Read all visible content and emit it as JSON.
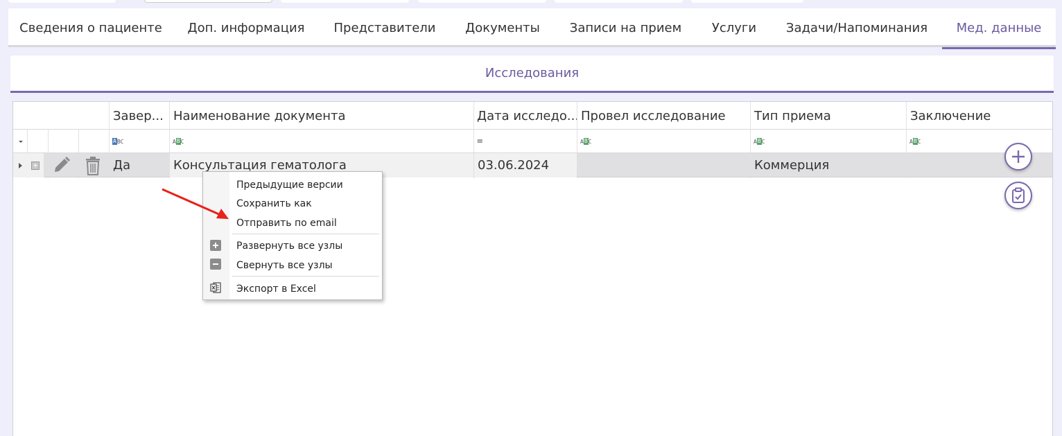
{
  "tabs": [
    {
      "label": "Сведения о пациенте",
      "active": false
    },
    {
      "label": "Доп. информация",
      "active": false
    },
    {
      "label": "Представители",
      "active": false
    },
    {
      "label": "Документы",
      "active": false
    },
    {
      "label": "Записи на прием",
      "active": false
    },
    {
      "label": "Услуги",
      "active": false
    },
    {
      "label": "Задачи/Напоминания",
      "active": false
    },
    {
      "label": "Мед. данные",
      "active": true
    }
  ],
  "section": {
    "title": "Исследования"
  },
  "grid": {
    "columns": [
      "Завер...",
      "Наименование документа",
      "Дата исследо...",
      "Провел исследование",
      "Тип приема",
      "Заключение"
    ],
    "rows": [
      {
        "completed": "Да",
        "name": "Консультация гематолога",
        "date": "03.06.2024",
        "conducted_by": "",
        "visit_type": "Коммерция",
        "conclusion": ""
      }
    ]
  },
  "context_menu": {
    "items": [
      {
        "label": "Предыдущие версии"
      },
      {
        "label": "Сохранить как"
      },
      {
        "label": "Отправить по email"
      },
      {
        "label": "Развернуть все узлы",
        "icon": "expand-icon"
      },
      {
        "label": "Свернуть все узлы",
        "icon": "collapse-icon"
      },
      {
        "label": "Экспорт в Excel",
        "icon": "excel-icon"
      }
    ]
  },
  "colors": {
    "accent": "#7a68ad",
    "annotation_arrow": "#e8221b"
  }
}
